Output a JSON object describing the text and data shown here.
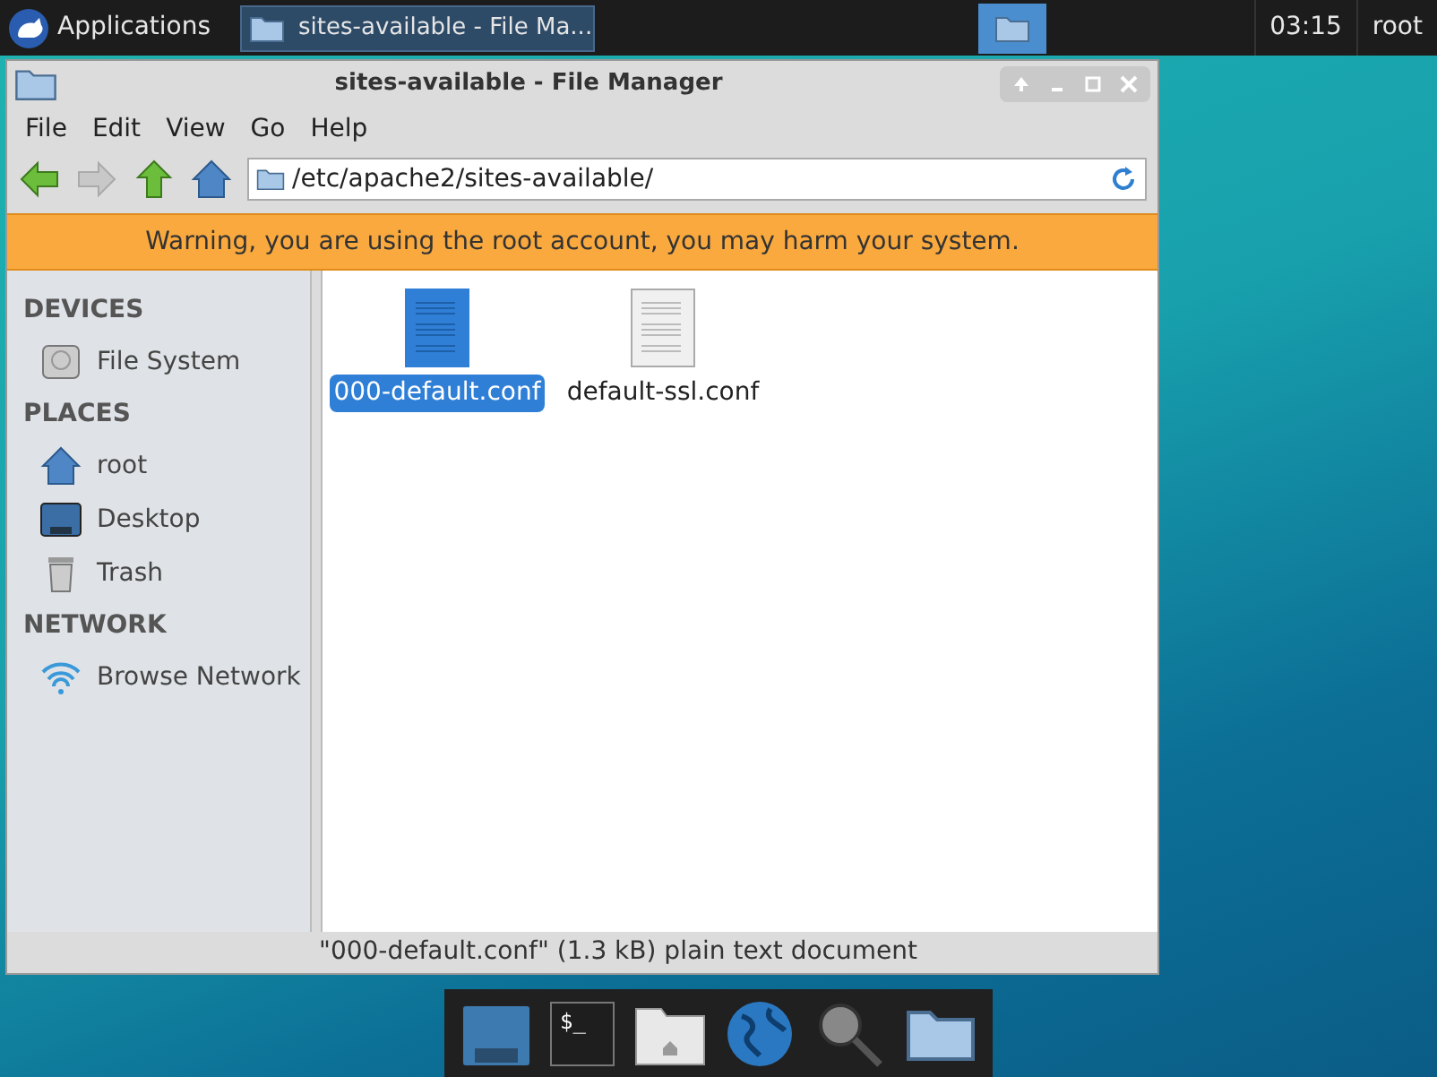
{
  "panel": {
    "menu_label": "Applications",
    "tasks": [
      {
        "label": "sites-available - File Ma...",
        "selected": true
      }
    ],
    "clock": "03:15",
    "user": "root"
  },
  "window": {
    "title": "sites-available - File Manager",
    "menu": [
      "File",
      "Edit",
      "View",
      "Go",
      "Help"
    ],
    "address": "/etc/apache2/sites-available/",
    "warning": "Warning, you are using the root account, you may harm your system.",
    "sidebar": [
      {
        "heading": "DEVICES",
        "items": [
          {
            "label": "File System",
            "kind": "drive"
          }
        ]
      },
      {
        "heading": "PLACES",
        "items": [
          {
            "label": "root",
            "kind": "home"
          },
          {
            "label": "Desktop",
            "kind": "desktop"
          },
          {
            "label": "Trash",
            "kind": "trash"
          }
        ]
      },
      {
        "heading": "NETWORK",
        "items": [
          {
            "label": "Browse Network",
            "kind": "network"
          }
        ]
      }
    ],
    "files": [
      {
        "name": "000-default.conf",
        "selected": true
      },
      {
        "name": "default-ssl.conf",
        "selected": false
      }
    ],
    "status": "\"000-default.conf\" (1.3 kB) plain text document"
  },
  "dock": [
    {
      "kind": "desktop"
    },
    {
      "kind": "terminal",
      "text": "$_"
    },
    {
      "kind": "home"
    },
    {
      "kind": "web"
    },
    {
      "kind": "search"
    },
    {
      "kind": "folder"
    }
  ]
}
